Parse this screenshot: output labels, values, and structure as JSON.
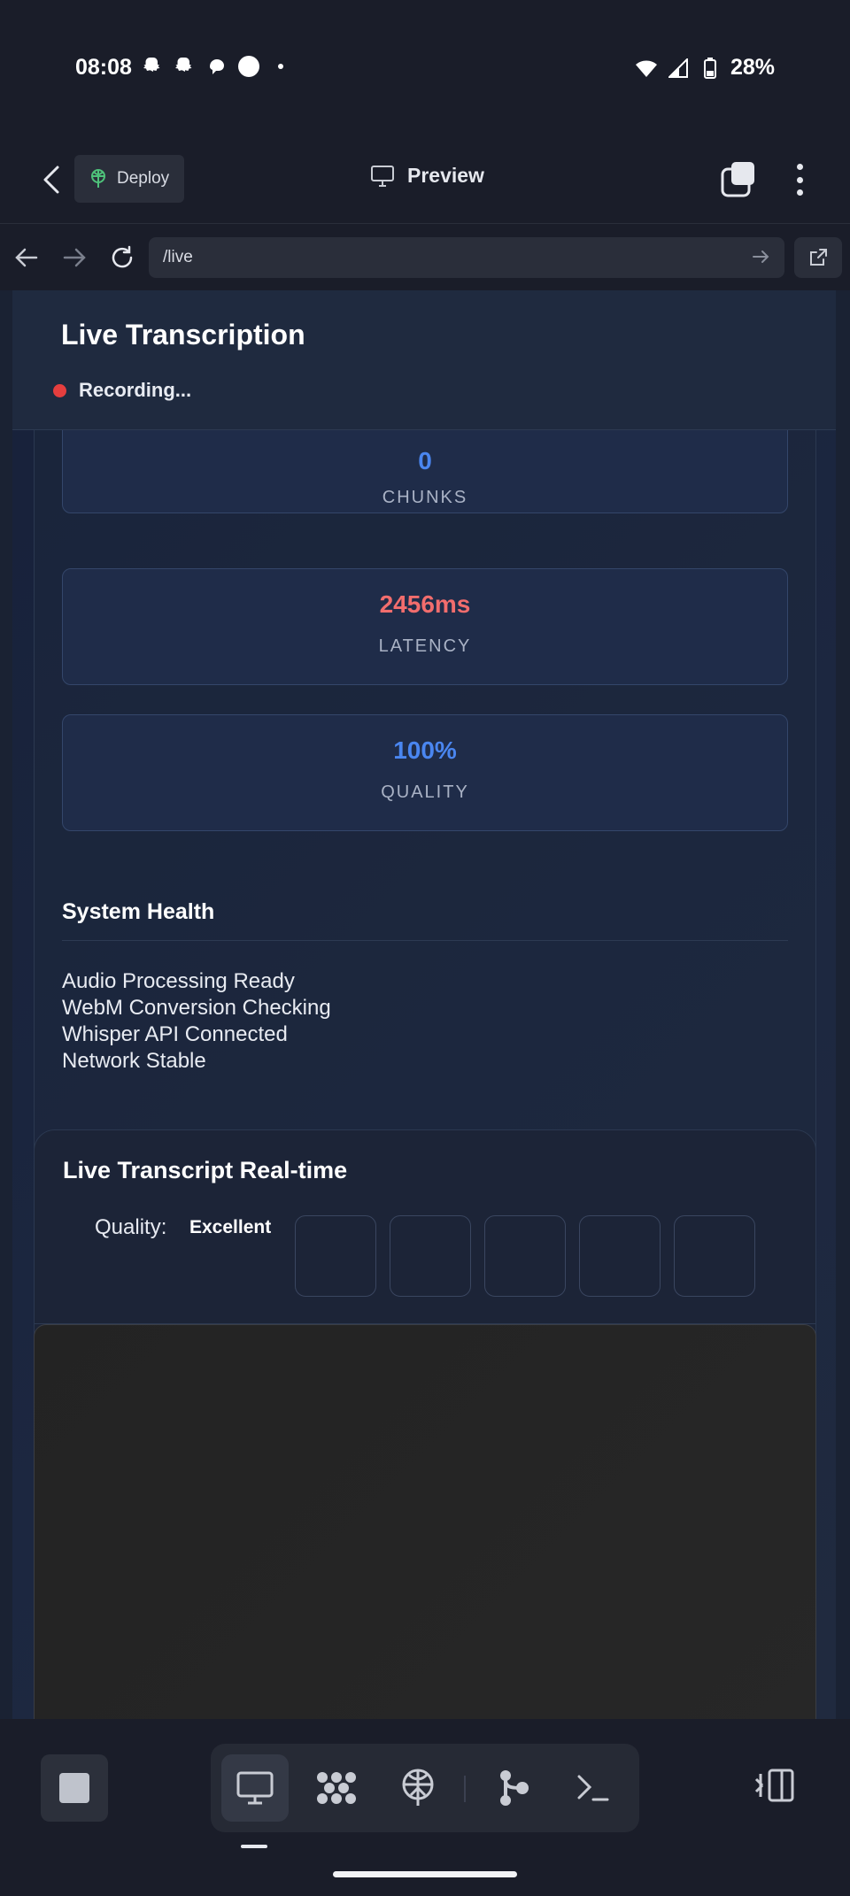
{
  "status_bar": {
    "time": "08:08",
    "battery": "28%",
    "icons": [
      "snapchat-icon",
      "snapchat-icon",
      "threads-icon",
      "circle-icon",
      "dot-icon",
      "wifi-icon",
      "signal-icon",
      "battery-icon"
    ]
  },
  "app_bar": {
    "deploy_label": "Deploy",
    "title": "Preview"
  },
  "browser": {
    "url": "/live"
  },
  "page": {
    "header_title": "Live Transcription",
    "recording_label": "Recording...",
    "stats": [
      {
        "value": "0",
        "label": "CHUNKS",
        "color": "#4a86f0"
      },
      {
        "value": "2456ms",
        "label": "LATENCY",
        "color": "#f26d6d"
      },
      {
        "value": "100%",
        "label": "QUALITY",
        "color": "#4a86f0"
      }
    ],
    "health": {
      "title": "System Health",
      "items": [
        "Audio Processing Ready",
        "WebM Conversion Checking",
        "Whisper API Connected",
        "Network Stable"
      ]
    },
    "transcript": {
      "title": "Live Transcript Real-time",
      "quality_label": "Quality:",
      "quality_value": "Excellent",
      "quality_box_count": 5
    }
  },
  "dock": {
    "tabs": [
      "preview-icon",
      "workflows-icon",
      "deploy-icon",
      "git-icon",
      "terminal-icon"
    ],
    "active_tab": "preview-icon"
  },
  "colors": {
    "accent_blue": "#4a86f0",
    "accent_red": "#f26d6d",
    "recording_red": "#e53e3e"
  }
}
